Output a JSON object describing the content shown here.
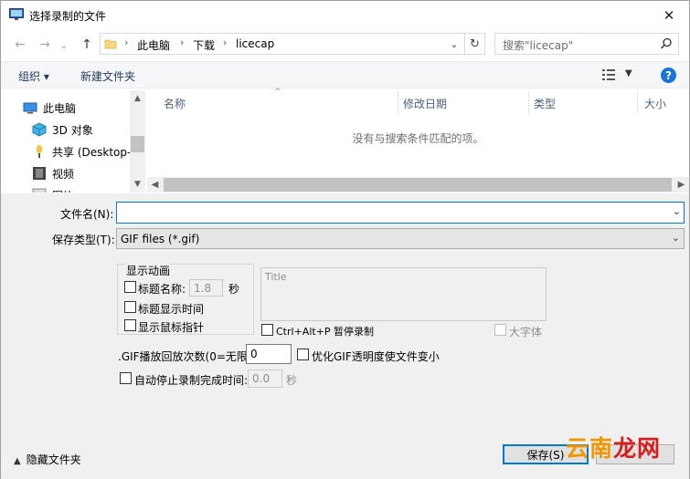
{
  "window": {
    "title": "选择录制的文件",
    "close_glyph": "✕"
  },
  "nav": {
    "back_glyph": "←",
    "forward_glyph": "→",
    "recent_glyph": "⌄",
    "up_glyph": "↑",
    "breadcrumb": [
      "此电脑",
      "下载",
      "licecap"
    ],
    "refresh_glyph": "↻",
    "search_placeholder": "搜索\"licecap\""
  },
  "toolbar": {
    "organize_label": "组织 ▾",
    "new_folder_label": "新建文件夹",
    "help_label": "?"
  },
  "sidebar": {
    "items": [
      {
        "label": "此电脑",
        "icon": "pc-icon"
      },
      {
        "label": "3D 对象",
        "icon": "cube-icon"
      },
      {
        "label": "共享 (Desktop-",
        "icon": "share-icon"
      },
      {
        "label": "视频",
        "icon": "video-icon"
      },
      {
        "label": "图片",
        "icon": "pictures-icon"
      }
    ]
  },
  "filelist": {
    "columns": [
      "名称",
      "修改日期",
      "类型",
      "大小"
    ],
    "empty_message": "没有与搜索条件匹配的项。"
  },
  "form": {
    "filename_label": "文件名(N):",
    "filename_value": "",
    "filetype_label": "保存类型(T):",
    "filetype_value": "GIF files (*.gif)",
    "group_title": "显示动画",
    "title_name_label": "标题名称:",
    "title_name_value": "1.8",
    "seconds_unit": "秒",
    "show_title_time_label": "标题显示时间",
    "show_cursor_label": "显示鼠标指针",
    "title_placeholder": "Title",
    "pause_label": "Ctrl+Alt+P 暂停录制",
    "large_font_label": "大字体",
    "gif_loop_label": ".GIF播放回放次数(0=无限):",
    "gif_loop_value": "0",
    "optimize_label": "优化GIF透明度使文件变小",
    "auto_stop_label": "自动停止录制完成时间:",
    "auto_stop_value": "0.0",
    "auto_stop_unit": "秒"
  },
  "footer": {
    "hide_folders_label": "隐藏文件夹",
    "save_label": "保存(S)"
  },
  "watermark": {
    "part_a": "云南",
    "part_b": "龙网"
  },
  "colors": {
    "accent": "#0078d7",
    "help_blue": "#1a73d9",
    "watermark_orange": "#f29600",
    "watermark_red": "#d61e1e"
  }
}
